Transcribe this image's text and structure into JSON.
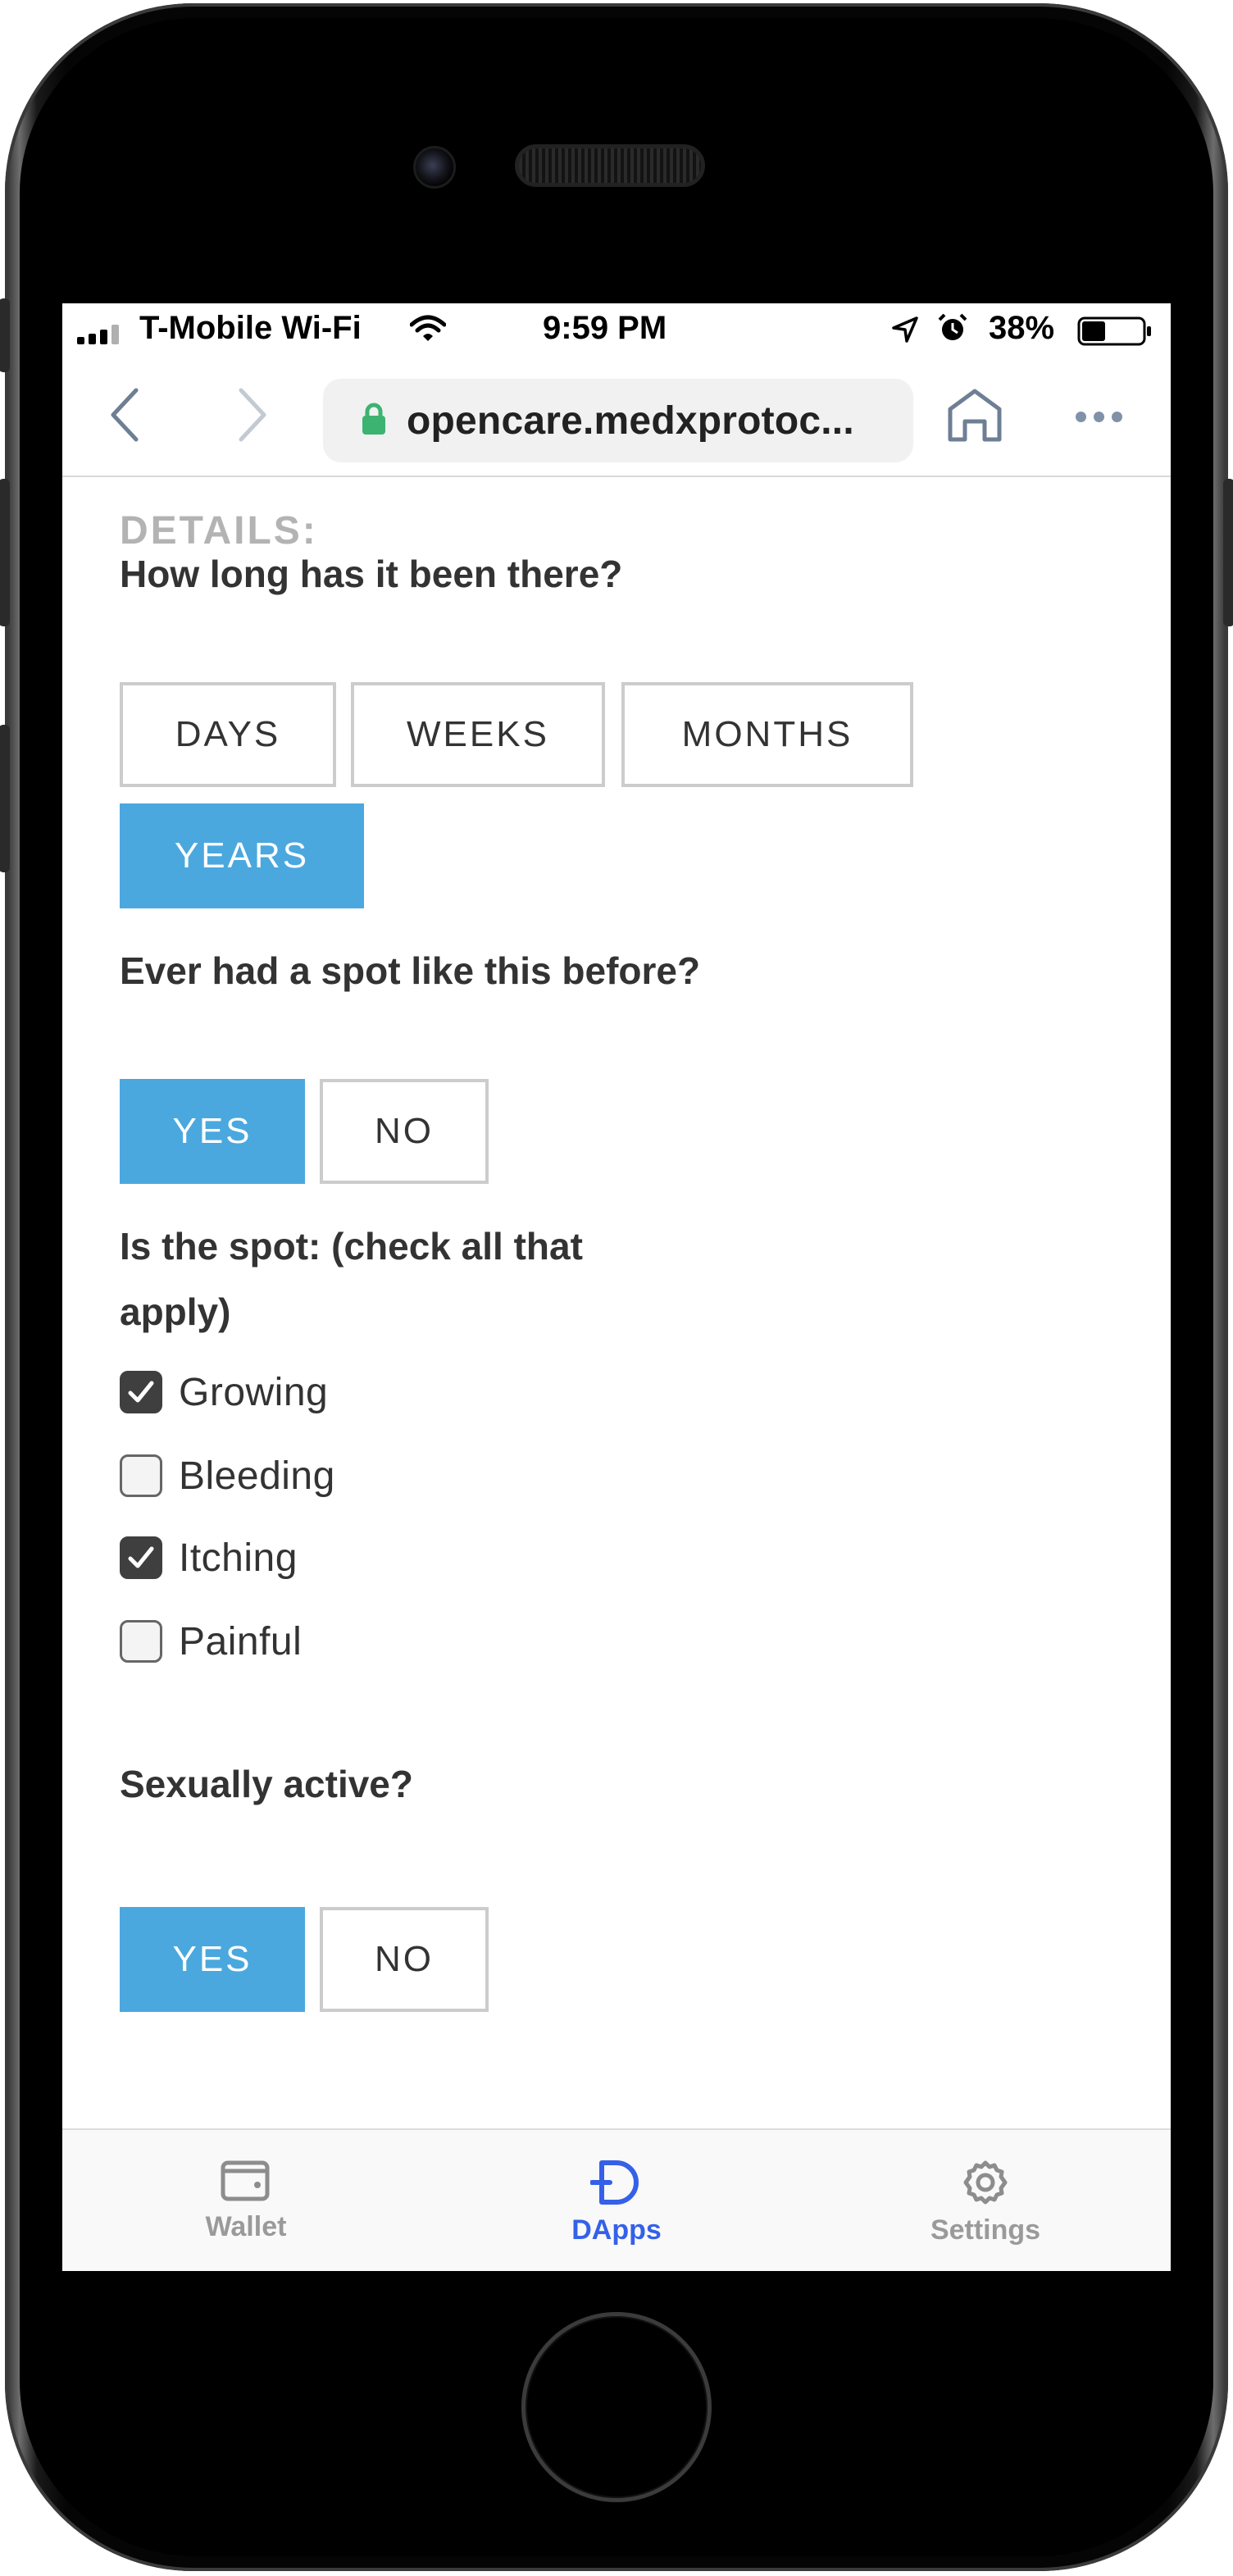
{
  "status_bar": {
    "carrier": "T-Mobile Wi-Fi",
    "time": "9:59 PM",
    "battery": "38%",
    "icons": [
      "signal-icon",
      "wifi-icon",
      "location-icon",
      "alarm-icon",
      "battery-icon"
    ]
  },
  "browser": {
    "url": "opencare.medxprotoc...",
    "icons": [
      "back-icon",
      "forward-icon",
      "lock-icon",
      "home-icon",
      "more-icon"
    ]
  },
  "form": {
    "section_title": "DETAILS:",
    "duration": {
      "question": "How long has it been there?",
      "options": [
        "DAYS",
        "WEEKS",
        "MONTHS",
        "YEARS"
      ],
      "selected": "YEARS"
    },
    "previous_spot": {
      "question": "Ever had a spot like this before?",
      "options": [
        "YES",
        "NO"
      ],
      "selected": "YES"
    },
    "spot_state": {
      "question_line1": "Is the spot: (check all that",
      "question_line2": "apply)",
      "items": [
        {
          "label": "Growing",
          "checked": true
        },
        {
          "label": "Bleeding",
          "checked": false
        },
        {
          "label": "Itching",
          "checked": true
        },
        {
          "label": "Painful",
          "checked": false
        }
      ]
    },
    "sexually_active": {
      "question": "Sexually active?",
      "options": [
        "YES",
        "NO"
      ],
      "selected": "YES"
    }
  },
  "tab_bar": {
    "tabs": [
      {
        "label": "Wallet",
        "icon": "wallet-icon",
        "active": false
      },
      {
        "label": "DApps",
        "icon": "dapps-icon",
        "active": true
      },
      {
        "label": "Settings",
        "icon": "gear-icon",
        "active": false
      }
    ],
    "active_color": "#3461e8",
    "inactive_color": "#9a9a9a"
  },
  "colors": {
    "selected_option": "#4aa8df",
    "option_border": "#cccccc",
    "lock": "#3cb371"
  }
}
